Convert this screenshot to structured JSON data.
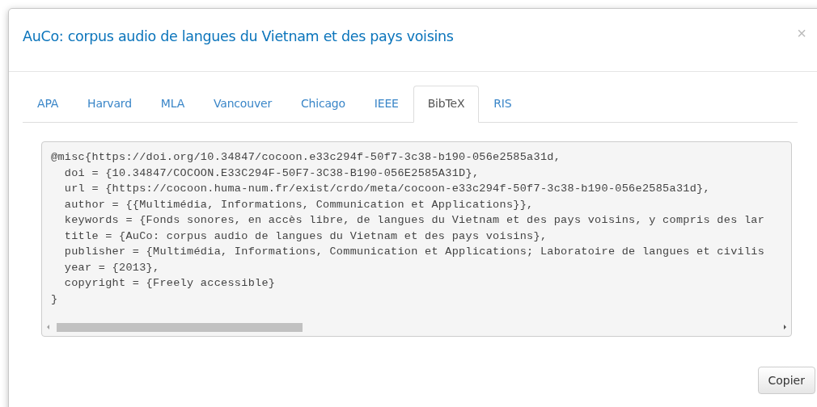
{
  "dialog": {
    "title": "AuCo: corpus audio de langues du Vietnam et des pays voisins",
    "close": "×"
  },
  "tabs": [
    {
      "label": "APA",
      "selected": false
    },
    {
      "label": "Harvard",
      "selected": false
    },
    {
      "label": "MLA",
      "selected": false
    },
    {
      "label": "Vancouver",
      "selected": false
    },
    {
      "label": "Chicago",
      "selected": false
    },
    {
      "label": "IEEE",
      "selected": false
    },
    {
      "label": "BibTeX",
      "selected": true
    },
    {
      "label": "RIS",
      "selected": false
    }
  ],
  "code_lines": [
    "@misc{https://doi.org/10.34847/cocoon.e33c294f-50f7-3c38-b190-056e2585a31d,",
    "  doi = {10.34847/COCOON.E33C294F-50F7-3C38-B190-056E2585A31D},",
    "  url = {https://cocoon.huma-num.fr/exist/crdo/meta/cocoon-e33c294f-50f7-3c38-b190-056e2585a31d},",
    "  author = {{Multimédia, Informations, Communication et Applications}},",
    "  keywords = {Fonds sonores, en accès libre, de langues du Vietnam et des pays voisins, y compris des lar",
    "  title = {AuCo: corpus audio de langues du Vietnam et des pays voisins},",
    "  publisher = {Multimédia, Informations, Communication et Applications; Laboratoire de langues et civilis",
    "  year = {2013},",
    "  copyright = {Freely accessible}",
    "}"
  ],
  "copy_button": "Copier"
}
